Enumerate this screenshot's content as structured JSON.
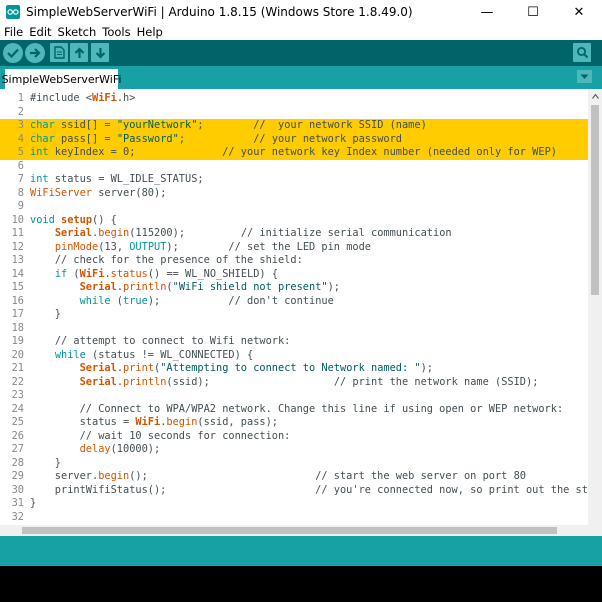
{
  "window": {
    "title": "SimpleWebServerWiFi | Arduino 1.8.15 (Windows Store 1.8.49.0)",
    "minimize_glyph": "—",
    "maximize_glyph": "☐",
    "close_glyph": "✕"
  },
  "menu": [
    "File",
    "Edit",
    "Sketch",
    "Tools",
    "Help"
  ],
  "toolbar": {
    "verify_icon": "checkmark-icon",
    "upload_icon": "arrow-right-icon",
    "new_icon": "new-file-icon",
    "open_icon": "arrow-up-icon",
    "save_icon": "arrow-down-icon",
    "serial_monitor_icon": "magnifier-icon"
  },
  "tabs": [
    {
      "label": "SimpleWebServerWiFi"
    }
  ],
  "colors": {
    "toolbar": "#006468",
    "tabbar": "#17a1a5",
    "highlight": "#ffcc00",
    "console": "#000000"
  },
  "code_lines": [
    {
      "n": "1",
      "hl": false,
      "tokens": [
        [
          "t-plain",
          "#include <"
        ],
        [
          "t-bold",
          "WiFi"
        ],
        [
          "t-plain",
          ".h>"
        ]
      ]
    },
    {
      "n": "2",
      "hl": false,
      "tokens": []
    },
    {
      "n": "3",
      "hl": true,
      "tokens": [
        [
          "t-key",
          "char"
        ],
        [
          "t-plain",
          " ssid[] = "
        ],
        [
          "t-str",
          "\"yourNetwork\""
        ],
        [
          "t-plain",
          ";        "
        ],
        [
          "t-cmt",
          "//  your network SSID (name)"
        ]
      ]
    },
    {
      "n": "4",
      "hl": true,
      "tokens": [
        [
          "t-key",
          "char"
        ],
        [
          "t-plain",
          " pass[] = "
        ],
        [
          "t-str",
          "\"Password\""
        ],
        [
          "t-plain",
          ";           "
        ],
        [
          "t-cmt",
          "// your network password"
        ]
      ]
    },
    {
      "n": "5",
      "hl": true,
      "tokens": [
        [
          "t-key",
          "int"
        ],
        [
          "t-plain",
          " keyIndex = 0;              "
        ],
        [
          "t-cmt",
          "// your network key Index number (needed only for WEP)"
        ]
      ]
    },
    {
      "n": "6",
      "hl": false,
      "tokens": []
    },
    {
      "n": "7",
      "hl": false,
      "tokens": [
        [
          "t-key",
          "int"
        ],
        [
          "t-plain",
          " status = WL_IDLE_STATUS;"
        ]
      ]
    },
    {
      "n": "8",
      "hl": false,
      "tokens": [
        [
          "t-fn",
          "WiFiServer"
        ],
        [
          "t-plain",
          " server(80);"
        ]
      ]
    },
    {
      "n": "9",
      "hl": false,
      "tokens": []
    },
    {
      "n": "10",
      "hl": false,
      "tokens": [
        [
          "t-key",
          "void"
        ],
        [
          "t-plain",
          " "
        ],
        [
          "t-bold",
          "setup"
        ],
        [
          "t-plain",
          "() {"
        ]
      ]
    },
    {
      "n": "11",
      "hl": false,
      "tokens": [
        [
          "t-plain",
          "    "
        ],
        [
          "t-bold",
          "Serial"
        ],
        [
          "t-plain",
          "."
        ],
        [
          "t-fn",
          "begin"
        ],
        [
          "t-plain",
          "(115200);         "
        ],
        [
          "t-cmt",
          "// initialize serial communication"
        ]
      ]
    },
    {
      "n": "12",
      "hl": false,
      "tokens": [
        [
          "t-plain",
          "    "
        ],
        [
          "t-fn",
          "pinMode"
        ],
        [
          "t-plain",
          "(13, "
        ],
        [
          "t-key",
          "OUTPUT"
        ],
        [
          "t-plain",
          ");        "
        ],
        [
          "t-cmt",
          "// set the LED pin mode"
        ]
      ]
    },
    {
      "n": "13",
      "hl": false,
      "tokens": [
        [
          "t-plain",
          "    "
        ],
        [
          "t-cmt",
          "// check for the presence of the shield:"
        ]
      ]
    },
    {
      "n": "14",
      "hl": false,
      "tokens": [
        [
          "t-plain",
          "    "
        ],
        [
          "t-key",
          "if"
        ],
        [
          "t-plain",
          " ("
        ],
        [
          "t-bold",
          "WiFi"
        ],
        [
          "t-plain",
          "."
        ],
        [
          "t-fn",
          "status"
        ],
        [
          "t-plain",
          "() == WL_NO_SHIELD) {"
        ]
      ]
    },
    {
      "n": "15",
      "hl": false,
      "tokens": [
        [
          "t-plain",
          "        "
        ],
        [
          "t-bold",
          "Serial"
        ],
        [
          "t-plain",
          "."
        ],
        [
          "t-fn",
          "println"
        ],
        [
          "t-plain",
          "("
        ],
        [
          "t-str",
          "\"WiFi shield not present\""
        ],
        [
          "t-plain",
          ");"
        ]
      ]
    },
    {
      "n": "16",
      "hl": false,
      "tokens": [
        [
          "t-plain",
          "        "
        ],
        [
          "t-key",
          "while"
        ],
        [
          "t-plain",
          " ("
        ],
        [
          "t-key",
          "true"
        ],
        [
          "t-plain",
          ");           "
        ],
        [
          "t-cmt",
          "// don't continue"
        ]
      ]
    },
    {
      "n": "17",
      "hl": false,
      "tokens": [
        [
          "t-plain",
          "    }"
        ]
      ]
    },
    {
      "n": "18",
      "hl": false,
      "tokens": []
    },
    {
      "n": "19",
      "hl": false,
      "tokens": [
        [
          "t-plain",
          "    "
        ],
        [
          "t-cmt",
          "// attempt to connect to Wifi network:"
        ]
      ]
    },
    {
      "n": "20",
      "hl": false,
      "tokens": [
        [
          "t-plain",
          "    "
        ],
        [
          "t-key",
          "while"
        ],
        [
          "t-plain",
          " (status != WL_CONNECTED) {"
        ]
      ]
    },
    {
      "n": "21",
      "hl": false,
      "tokens": [
        [
          "t-plain",
          "        "
        ],
        [
          "t-bold",
          "Serial"
        ],
        [
          "t-plain",
          "."
        ],
        [
          "t-fn",
          "print"
        ],
        [
          "t-plain",
          "("
        ],
        [
          "t-str",
          "\"Attempting to connect to Network named: \""
        ],
        [
          "t-plain",
          ");"
        ]
      ]
    },
    {
      "n": "22",
      "hl": false,
      "tokens": [
        [
          "t-plain",
          "        "
        ],
        [
          "t-bold",
          "Serial"
        ],
        [
          "t-plain",
          "."
        ],
        [
          "t-fn",
          "println"
        ],
        [
          "t-plain",
          "(ssid);                    "
        ],
        [
          "t-cmt",
          "// print the network name (SSID);"
        ]
      ]
    },
    {
      "n": "23",
      "hl": false,
      "tokens": []
    },
    {
      "n": "24",
      "hl": false,
      "tokens": [
        [
          "t-plain",
          "        "
        ],
        [
          "t-cmt",
          "// Connect to WPA/WPA2 network. Change this line if using open or WEP network:"
        ]
      ]
    },
    {
      "n": "25",
      "hl": false,
      "tokens": [
        [
          "t-plain",
          "        status = "
        ],
        [
          "t-bold",
          "WiFi"
        ],
        [
          "t-plain",
          "."
        ],
        [
          "t-fn",
          "begin"
        ],
        [
          "t-plain",
          "(ssid, pass);"
        ]
      ]
    },
    {
      "n": "26",
      "hl": false,
      "tokens": [
        [
          "t-plain",
          "        "
        ],
        [
          "t-cmt",
          "// wait 10 seconds for connection:"
        ]
      ]
    },
    {
      "n": "27",
      "hl": false,
      "tokens": [
        [
          "t-plain",
          "        "
        ],
        [
          "t-fn",
          "delay"
        ],
        [
          "t-plain",
          "(10000);"
        ]
      ]
    },
    {
      "n": "28",
      "hl": false,
      "tokens": [
        [
          "t-plain",
          "    }"
        ]
      ]
    },
    {
      "n": "29",
      "hl": false,
      "tokens": [
        [
          "t-plain",
          "    server."
        ],
        [
          "t-fn",
          "begin"
        ],
        [
          "t-plain",
          "();                           "
        ],
        [
          "t-cmt",
          "// start the web server on port 80"
        ]
      ]
    },
    {
      "n": "30",
      "hl": false,
      "tokens": [
        [
          "t-plain",
          "    printWifiStatus();                        "
        ],
        [
          "t-cmt",
          "// you're connected now, so print out the status"
        ]
      ]
    },
    {
      "n": "31",
      "hl": false,
      "tokens": [
        [
          "t-plain",
          "}"
        ]
      ]
    },
    {
      "n": "32",
      "hl": false,
      "tokens": []
    }
  ]
}
